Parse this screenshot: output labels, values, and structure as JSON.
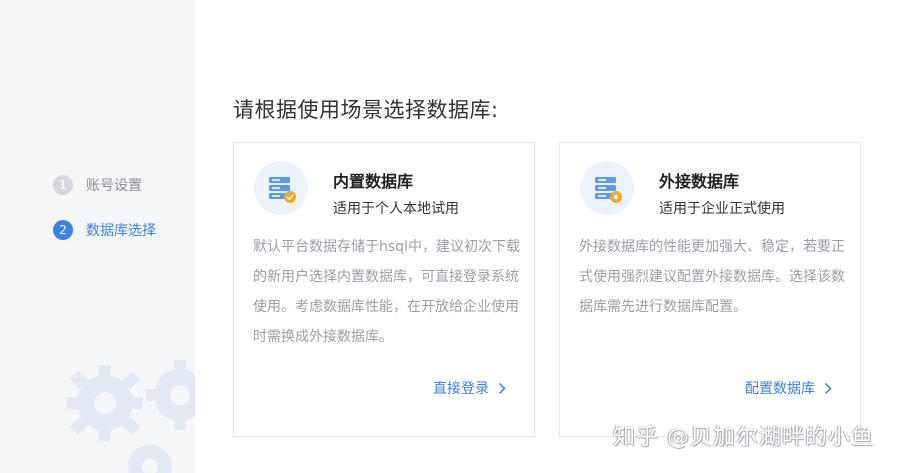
{
  "sidebar": {
    "steps": [
      {
        "number": "1",
        "label": "账号设置",
        "state": "done"
      },
      {
        "number": "2",
        "label": "数据库选择",
        "state": "active"
      }
    ]
  },
  "main": {
    "heading": "请根据使用场景选择数据库:",
    "cards": [
      {
        "icon": "database-check-icon",
        "title": "内置数据库",
        "subtitle": "适用于个人本地试用",
        "description": "默认平台数据存储于hsql中，建议初次下载的新用户选择内置数据库，可直接登录系统使用。考虑数据库性能，在开放给企业使用时需换成外接数据库。",
        "action": "直接登录"
      },
      {
        "icon": "database-gear-icon",
        "title": "外接数据库",
        "subtitle": "适用于企业正式使用",
        "description": "外接数据库的性能更加强大、稳定，若要正式使用强烈建议配置外接数据库。选择该数据库需先进行数据库配置。",
        "action": "配置数据库"
      }
    ]
  },
  "watermark": "知乎 @贝加尔湖畔的小鱼",
  "colors": {
    "accent": "#3d82e8",
    "icon_orange": "#f5a623",
    "sidebar_bg": "#f5f6f8"
  }
}
